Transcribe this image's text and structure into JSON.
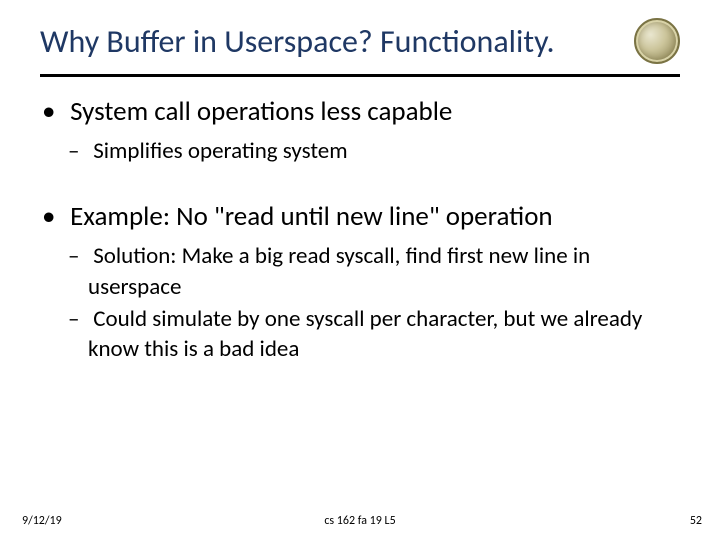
{
  "title": "Why Buffer in Userspace? Functionality.",
  "bullets": {
    "b1": "System call operations less capable",
    "b1_sub": {
      "s1": "Simplifies operating system"
    },
    "b2": "Example: No \"read until new line\" operation",
    "b2_sub": {
      "s1": "Solution: Make a big read syscall, find first new line in userspace",
      "s2": "Could simulate by one syscall per character, but we already know this is a bad idea"
    }
  },
  "footer": {
    "date": "9/12/19",
    "center": "cs 162 fa 19 L5",
    "page": "52"
  }
}
